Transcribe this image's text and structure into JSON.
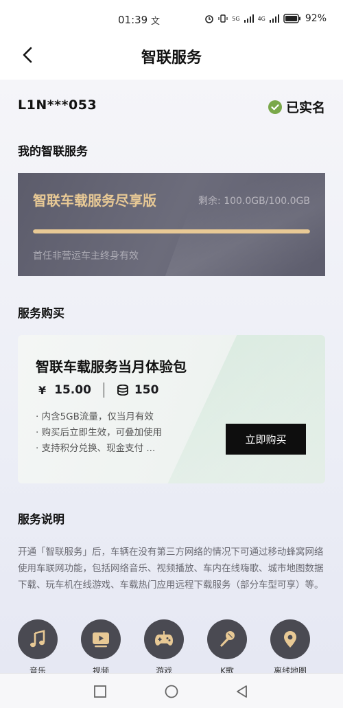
{
  "status_bar": {
    "time": "01:39",
    "extra": "文",
    "network_1": "5G",
    "network_2": "4G",
    "battery": "92%"
  },
  "header": {
    "title": "智联服务"
  },
  "account": {
    "id": "L1N***053",
    "verified_label": "已实名"
  },
  "my_service": {
    "section_title": "我的智联服务",
    "card": {
      "name": "智联车载服务尽享版",
      "remain": "剩余: 100.0GB/100.0GB",
      "remain_fraction": 1.0,
      "note": "首任非营运车主终身有效"
    }
  },
  "purchase": {
    "section_title": "服务购买",
    "package": {
      "name": "智联车载服务当月体验包",
      "price_symbol": "¥",
      "price": "15.00",
      "coins": "150",
      "features": [
        "· 内含5GB流量，仅当月有效",
        "· 购买后立即生效，可叠加使用",
        "· 支持积分兑换、现金支付 ..."
      ],
      "buy_label": "立即购买"
    }
  },
  "description": {
    "section_title": "服务说明",
    "text": "开通「智联服务」后，车辆在没有第三方网络的情况下可通过移动蜂窝网络使用车联网功能，包括网络音乐、视频播放、车内在线嗨歌、城市地图数据下载、玩车机在线游戏、车载热门应用远程下载服务（部分车型可享）等。"
  },
  "features": [
    {
      "label": "音乐",
      "icon": "music-note-icon"
    },
    {
      "label": "视频",
      "icon": "video-play-icon"
    },
    {
      "label": "游戏",
      "icon": "gamepad-icon"
    },
    {
      "label": "K歌",
      "icon": "microphone-icon"
    },
    {
      "label": "离线地图",
      "icon": "map-pin-icon"
    }
  ],
  "colors": {
    "accent_gold": "#e8c995",
    "verified_green": "#7aa84a",
    "card_dark": "#5c5c6b",
    "icon_circle": "#4a4a52"
  }
}
